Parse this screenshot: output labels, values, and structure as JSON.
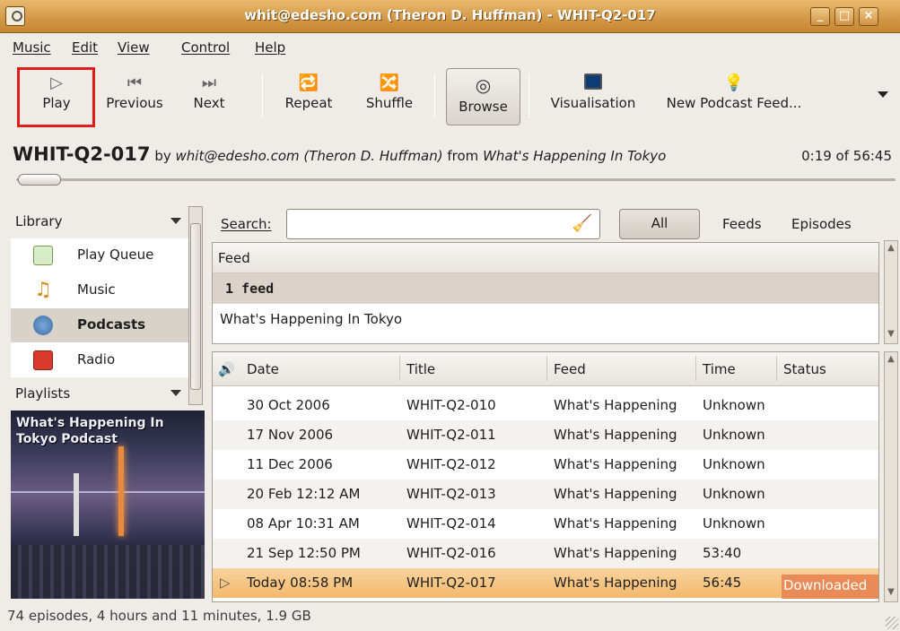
{
  "window": {
    "title": "whit@edesho.com (Theron D. Huffman) - WHIT-Q2-017"
  },
  "menu": [
    "Music",
    "Edit",
    "View",
    "Control",
    "Help"
  ],
  "toolbar": {
    "play": "Play",
    "previous": "Previous",
    "next": "Next",
    "repeat": "Repeat",
    "shuffle": "Shuffle",
    "browse": "Browse",
    "visualisation": "Visualisation",
    "new_podcast": "New Podcast Feed...",
    "overflow_icon": "chevron-down-icon"
  },
  "now_playing": {
    "song": "WHIT-Q2-017",
    "by_label": "by",
    "artist": "whit@edesho.com (Theron D. Huffman)",
    "from_label": "from",
    "album": "What's Happening In Tokyo",
    "time": "0:19 of 56:45",
    "progress_fraction": 0.0056
  },
  "sidebar": {
    "library_label": "Library",
    "items": [
      {
        "label": "Play Queue",
        "icon": "play-queue-icon"
      },
      {
        "label": "Music",
        "icon": "music-note-icon"
      },
      {
        "label": "Podcasts",
        "icon": "podcast-icon"
      },
      {
        "label": "Radio",
        "icon": "radio-icon"
      }
    ],
    "playlists_label": "Playlists",
    "cover_text": "What's Happening In Tokyo Podcast"
  },
  "search": {
    "label": "Search:",
    "value": "",
    "filters": [
      "All",
      "Feeds",
      "Episodes"
    ],
    "active_filter": "All"
  },
  "feeds": {
    "header": "Feed",
    "group": "1 feed",
    "rows": [
      "What's Happening In Tokyo"
    ]
  },
  "episodes": {
    "columns": [
      "Date",
      "Title",
      "Feed",
      "Time",
      "Status"
    ],
    "rows": [
      {
        "date": "30 Oct 2006",
        "title": "WHIT-Q2-010",
        "feed": "What's Happening",
        "time": "Unknown",
        "status": ""
      },
      {
        "date": "17 Nov 2006",
        "title": "WHIT-Q2-011",
        "feed": "What's Happening",
        "time": "Unknown",
        "status": ""
      },
      {
        "date": "11 Dec 2006",
        "title": "WHIT-Q2-012",
        "feed": "What's Happening",
        "time": "Unknown",
        "status": ""
      },
      {
        "date": "20 Feb 12:12 AM",
        "title": "WHIT-Q2-013",
        "feed": "What's Happening",
        "time": "Unknown",
        "status": ""
      },
      {
        "date": "08 Apr 10:31 AM",
        "title": "WHIT-Q2-014",
        "feed": "What's Happening",
        "time": "Unknown",
        "status": ""
      },
      {
        "date": "21 Sep 12:50 PM",
        "title": "WHIT-Q2-016",
        "feed": "What's Happening",
        "time": "53:40",
        "status": ""
      },
      {
        "date": "Today 08:58 PM",
        "title": "WHIT-Q2-017",
        "feed": "What's Happening",
        "time": "56:45",
        "status": "Downloaded"
      }
    ]
  },
  "statusbar": "74 episodes, 4 hours and 11 minutes, 1.9 GB"
}
